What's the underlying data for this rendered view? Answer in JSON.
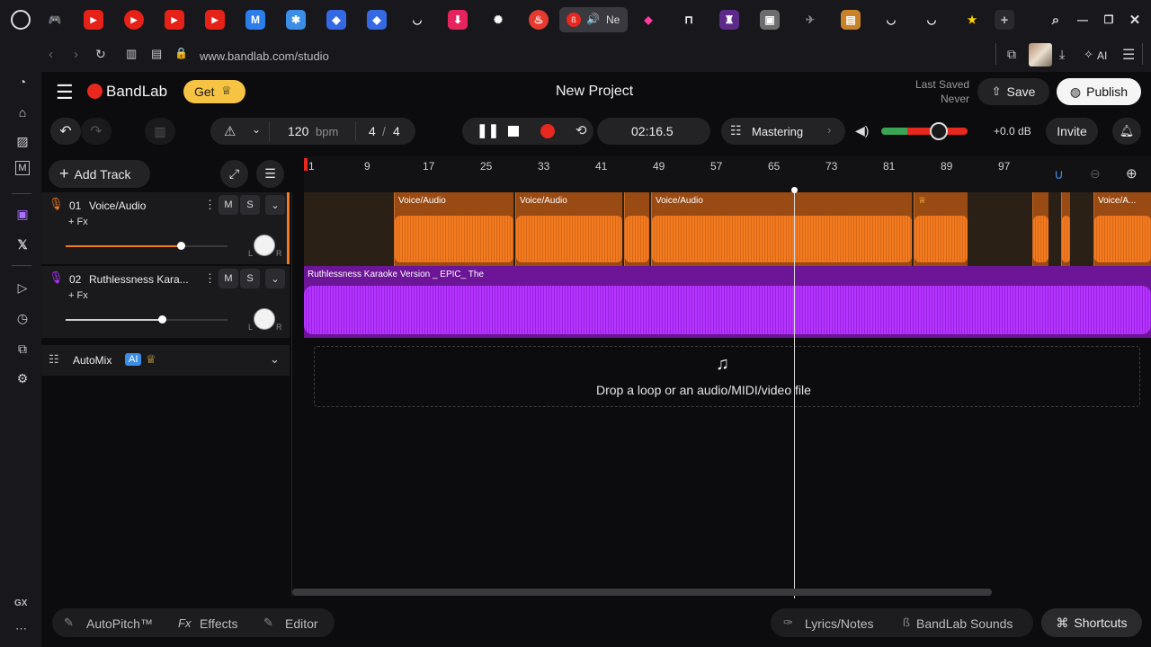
{
  "browser": {
    "active_tab_label": "Ne",
    "url": "www.bandlab.com/studio",
    "ai_label": "AI",
    "gx_label": "GX"
  },
  "header": {
    "brand": "BandLab",
    "get_label": "Get",
    "project_title": "New Project",
    "last_saved_label": "Last Saved",
    "last_saved_value": "Never",
    "save_label": "Save",
    "publish_label": "Publish"
  },
  "transport": {
    "tempo_value": "120",
    "tempo_unit": "bpm",
    "time_sig_top": "4",
    "time_sig_sep": "/",
    "time_sig_bottom": "4",
    "time": "02:16.5",
    "mastering_label": "Mastering",
    "volume_db": "+0.0 dB",
    "invite_label": "Invite"
  },
  "toolbar": {
    "add_track_label": "Add Track"
  },
  "ruler": [
    "1",
    "9",
    "17",
    "25",
    "33",
    "41",
    "49",
    "57",
    "65",
    "73",
    "81",
    "89",
    "97"
  ],
  "tracks": [
    {
      "number": "01",
      "name": "Voice/Audio",
      "fx": "+ Fx",
      "mute": "M",
      "solo": "S",
      "pan_l": "L",
      "pan_r": "R",
      "color": "#f47a1f",
      "volume": 0.82
    },
    {
      "number": "02",
      "name": "Ruthlessness Kara...",
      "fx": "+ Fx",
      "mute": "M",
      "solo": "S",
      "pan_l": "L",
      "pan_r": "R",
      "color": "#b533ff",
      "volume": 0.68
    }
  ],
  "clips": {
    "voice_label": "Voice/Audio",
    "voice_label_short": "Voice/A...",
    "karaoke_label": "Ruthlessness Karaoke Version _ EPIC_ The"
  },
  "automix": {
    "label": "AutoMix",
    "badge": "AI"
  },
  "dropzone": {
    "text": "Drop a loop or an audio/MIDI/video file"
  },
  "bottom": {
    "autopitch": "AutoPitch™",
    "effects_prefix": "Fx",
    "effects": "Effects",
    "editor": "Editor",
    "lyrics": "Lyrics/Notes",
    "sounds": "BandLab Sounds",
    "shortcuts": "Shortcuts"
  },
  "colors": {
    "accent": "#e8281e",
    "brand_gold": "#f6c343",
    "voice": "#f47a1f",
    "karaoke": "#b533ff"
  }
}
